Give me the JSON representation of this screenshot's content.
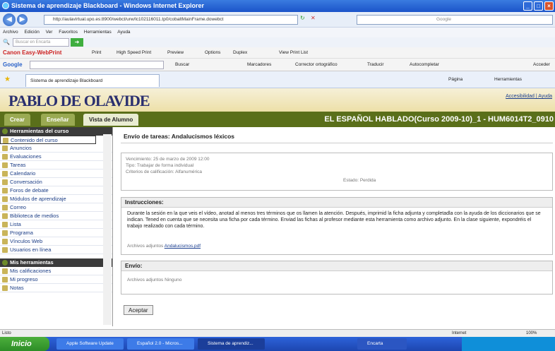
{
  "window": {
    "title": "Sistema de aprendizaje Blackboard - Windows Internet Explorer"
  },
  "address": {
    "url": "http://aulavirtual.upo.es:8900/webct/urw/lc102116011.tp0/cobaltMainFrame.dowebct",
    "search_placeholder": "Google"
  },
  "menu": [
    "Archivo",
    "Edición",
    "Ver",
    "Favoritos",
    "Herramientas",
    "Ayuda"
  ],
  "toolbar": {
    "search_placeholder": "Buscar en Encarta",
    "canon": "Canon Easy-WebPrint",
    "print": "Print",
    "high_speed": "High Speed Print",
    "preview": "Preview",
    "options": "Options",
    "duplex": "Duplex",
    "view_print_list": "View Print List"
  },
  "google": {
    "logo": "Google",
    "buscar": "Buscar",
    "marcadores": "Marcadores",
    "corrector": "Corrector ortográfico",
    "traducir": "Traducir",
    "autocompletar": "Autocompletar",
    "acceder": "Acceder"
  },
  "favorites": {
    "tab_title": "Sistema de aprendizaje Blackboard",
    "pagina": "Página",
    "herramientas": "Herramientas"
  },
  "header": {
    "logo": "PABLO DE OLAVIDE",
    "accessibility": "Accesibilidad | Ayuda"
  },
  "nav": {
    "tabs": [
      "Crear",
      "Enseñar",
      "Vista de Alumno"
    ],
    "course": "EL ESPAÑOL HABLADO(Curso 2009-10)_1 - HUM6014T2_0910"
  },
  "sidebar": {
    "course_tools": "Herramientas del curso",
    "items": [
      "Contenido del curso",
      "Anuncios",
      "Evaluaciones",
      "Tareas",
      "Calendario",
      "Conversación",
      "Foros de debate",
      "Módulos de aprendizaje",
      "Correo",
      "Biblioteca de medios",
      "Lista",
      "Programa",
      "Vínculos Web",
      "Usuarios en línea"
    ],
    "my_tools": "Mis herramientas",
    "my_items": [
      "Mis calificaciones",
      "Mi progreso",
      "Notas"
    ]
  },
  "main": {
    "title": "Envío de tareas: Andalucismos léxicos",
    "due": "Vencimiento: 25 de marzo de 2009 12:00",
    "type": "Tipo: Trabajar de forma individual",
    "criteria": "Criterios de calificación: Alfanumérica",
    "status": "Estado: Perdida",
    "instructions_head": "Instrucciones:",
    "instructions": "Durante la sesión en la que veis el vídeo, anotad al menos tres términos que os llamen la atención. Después, imprimid la ficha adjunta y completadla con la ayuda de los diccionarios que se indican. Tened en cuenta que se necesita una ficha por cada término. Enviad las fichas al profesor mediante esta herramienta como archivo adjunto. En la clase siguiente, expondréis el trabajo realizado con cada término.",
    "attach_label": "Archivos adjuntos",
    "attach_file": "Andalucismos.pdf",
    "envio_head": "Envío:",
    "envio_attach": "Archivos adjuntos Ninguno",
    "accept": "Aceptar"
  },
  "status": {
    "left": "Listo",
    "zone": "Internet",
    "zoom": "100%"
  },
  "taskbar": {
    "start": "Inicio",
    "tasks": [
      "Apple Software Update",
      "Español 2.0 - Micros...",
      "Sistema de aprendiz..."
    ],
    "encarta": "Encarta"
  }
}
